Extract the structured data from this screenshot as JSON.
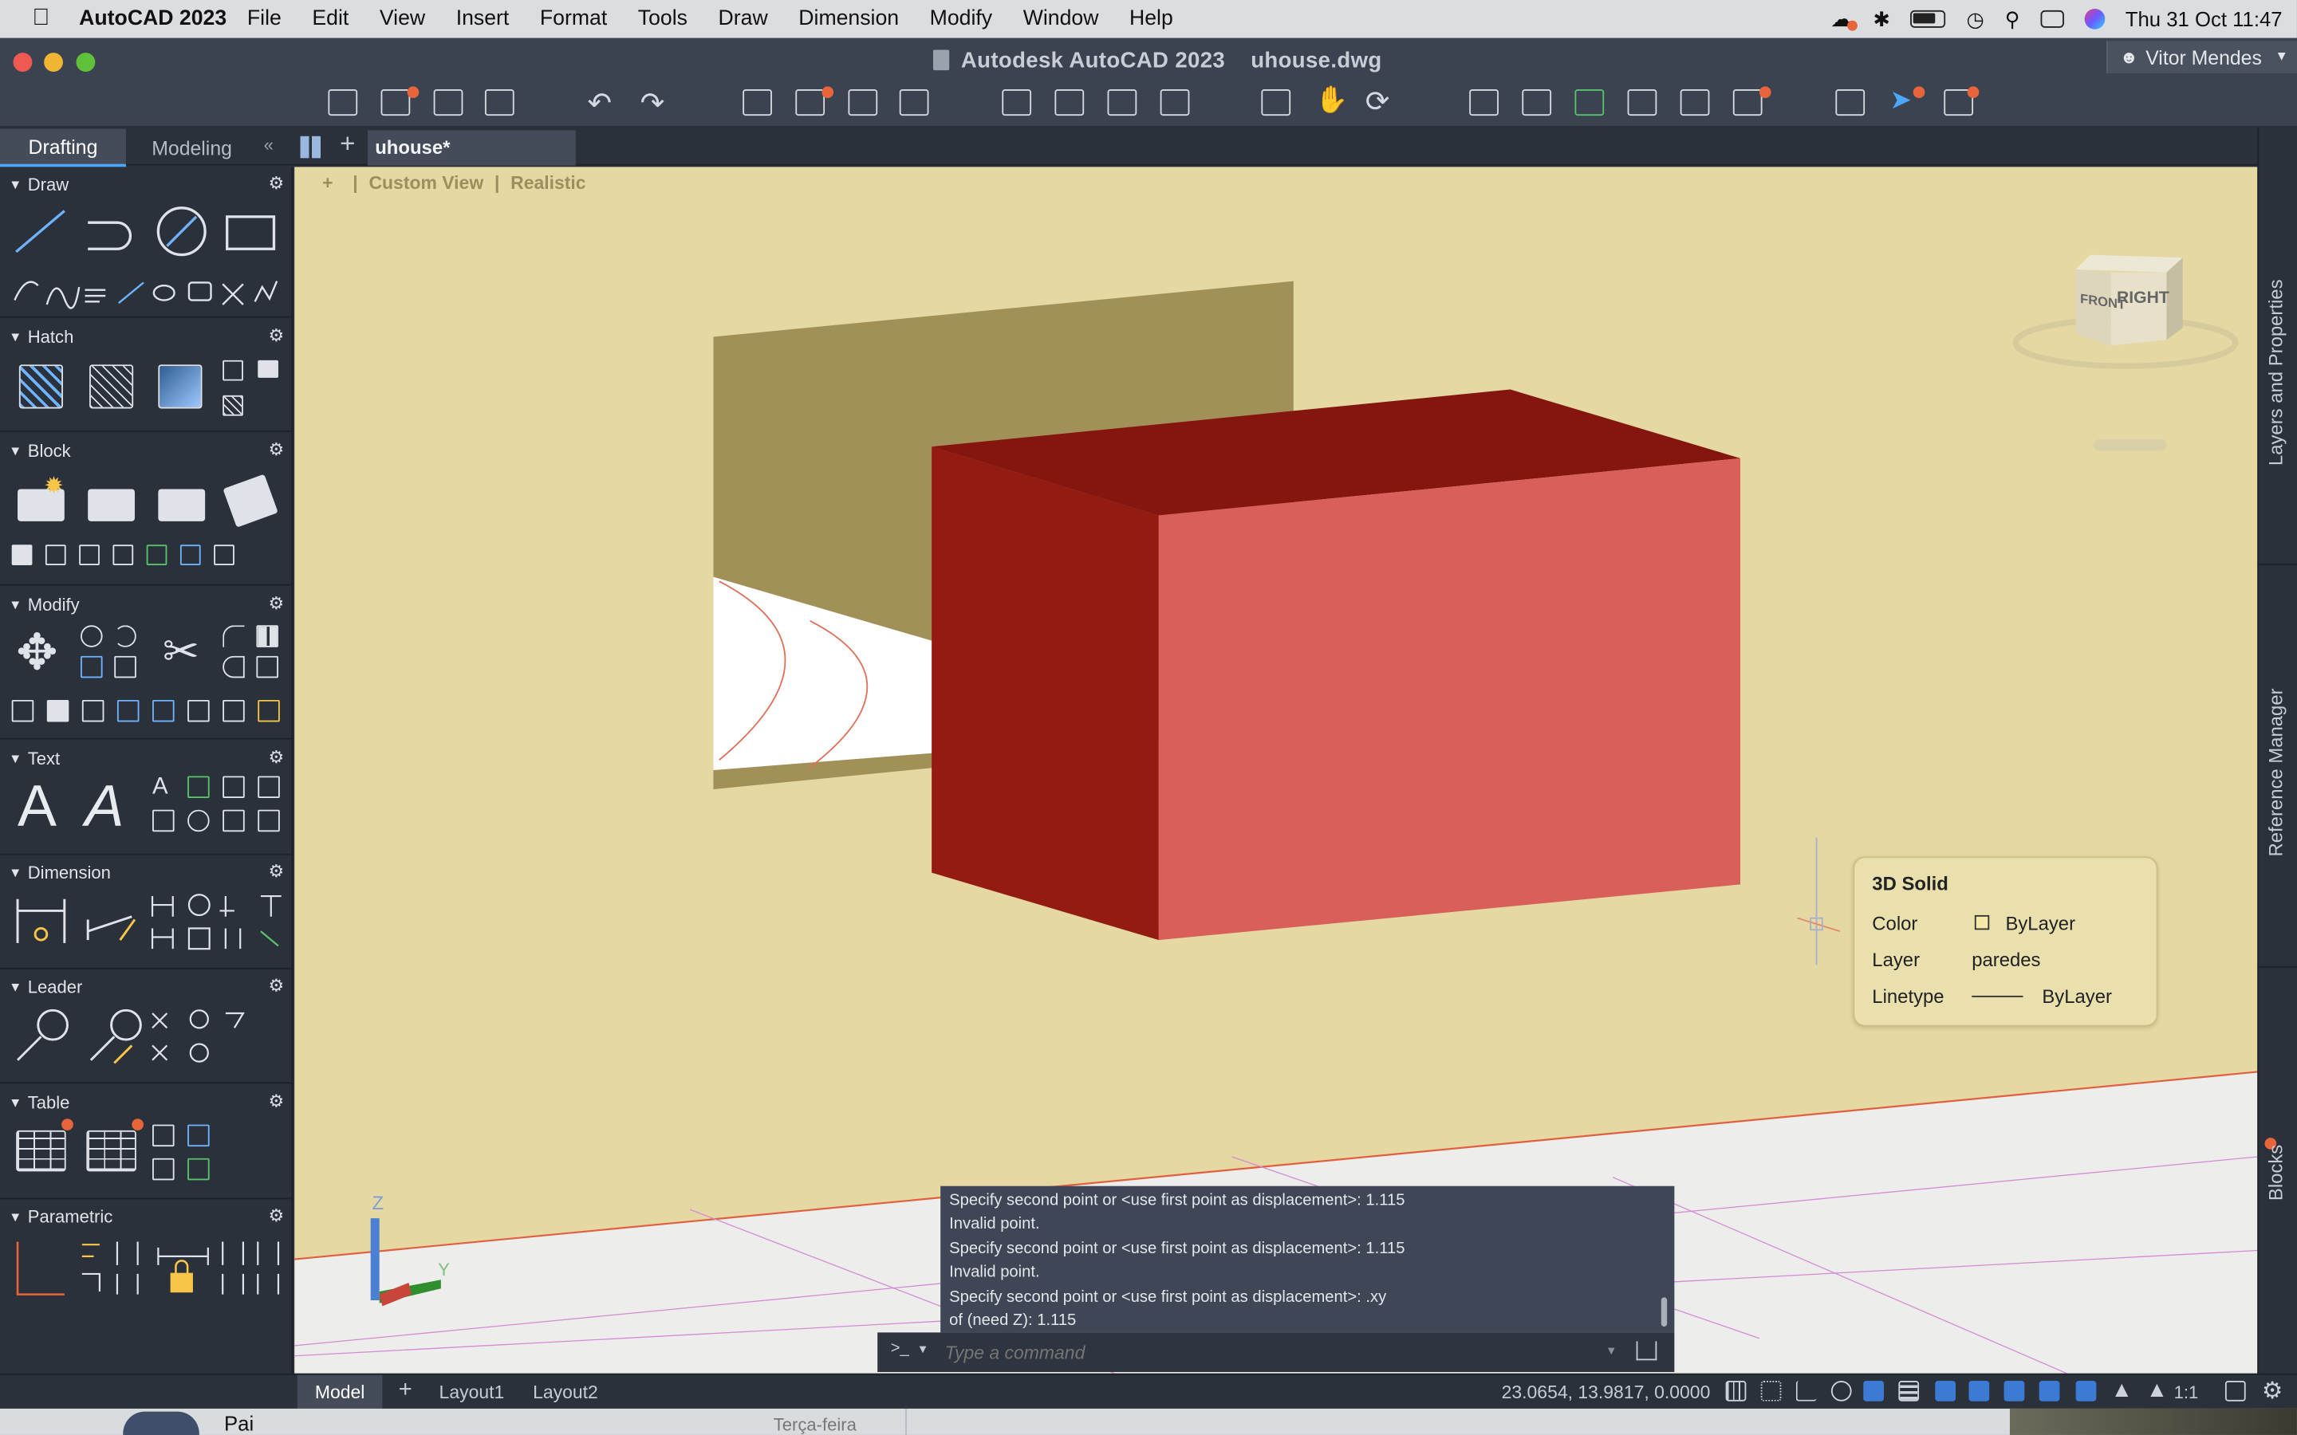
{
  "menubar": {
    "app_name": "AutoCAD 2023",
    "items": [
      "File",
      "Edit",
      "View",
      "Insert",
      "Format",
      "Tools",
      "Draw",
      "Dimension",
      "Modify",
      "Window",
      "Help"
    ],
    "datetime": "Thu 31 Oct  11:47"
  },
  "titlebar": {
    "title": "Autodesk AutoCAD 2023    uhouse.dwg",
    "user": "Vitor Mendes"
  },
  "workspace": {
    "tabs": [
      "Drafting",
      "Modeling"
    ],
    "active_tab": "Drafting",
    "document_tab": "uhouse*"
  },
  "palette": {
    "sections": [
      "Draw",
      "Hatch",
      "Block",
      "Modify",
      "Text",
      "Dimension",
      "Leader",
      "Table",
      "Parametric"
    ]
  },
  "viewport": {
    "plus": "+",
    "view": "Custom View",
    "style": "Realistic",
    "viewcube_front": "FRONT",
    "viewcube_right": "RIGHT"
  },
  "right_panel": {
    "tabs": [
      "Layers and Properties",
      "Reference Manager",
      "Blocks"
    ]
  },
  "properties_popup": {
    "title": "3D Solid",
    "rows": [
      {
        "label": "Color",
        "value": "ByLayer"
      },
      {
        "label": "Layer",
        "value": "paredes"
      },
      {
        "label": "Linetype",
        "value": "ByLayer"
      }
    ]
  },
  "command_line": {
    "history": [
      "Specify second point or <use first point as displacement>: 1.115",
      "Invalid point.",
      "Specify second point or <use first point as displacement>: 1.115",
      "Invalid point.",
      "Specify second point or <use first point as displacement>: .xy",
      "of (need Z): 1.115"
    ],
    "prompt_symbol": ">_",
    "placeholder": "Type a command"
  },
  "statusbar": {
    "layout_tabs": [
      "Model",
      "Layout1",
      "Layout2"
    ],
    "active_layout": "Model",
    "coordinates": "23.0654, 13.9817, 0.0000",
    "scale": "1:1"
  },
  "dock": {
    "item_name": "Pai",
    "item_date": "Terça-feira"
  },
  "colors": {
    "viewport_bg": "#e5d8a2",
    "box_front": "#d95f5a",
    "box_side": "#931b12",
    "box_top": "#84150f",
    "wall": "#a19159",
    "accent": "#e8643a"
  }
}
